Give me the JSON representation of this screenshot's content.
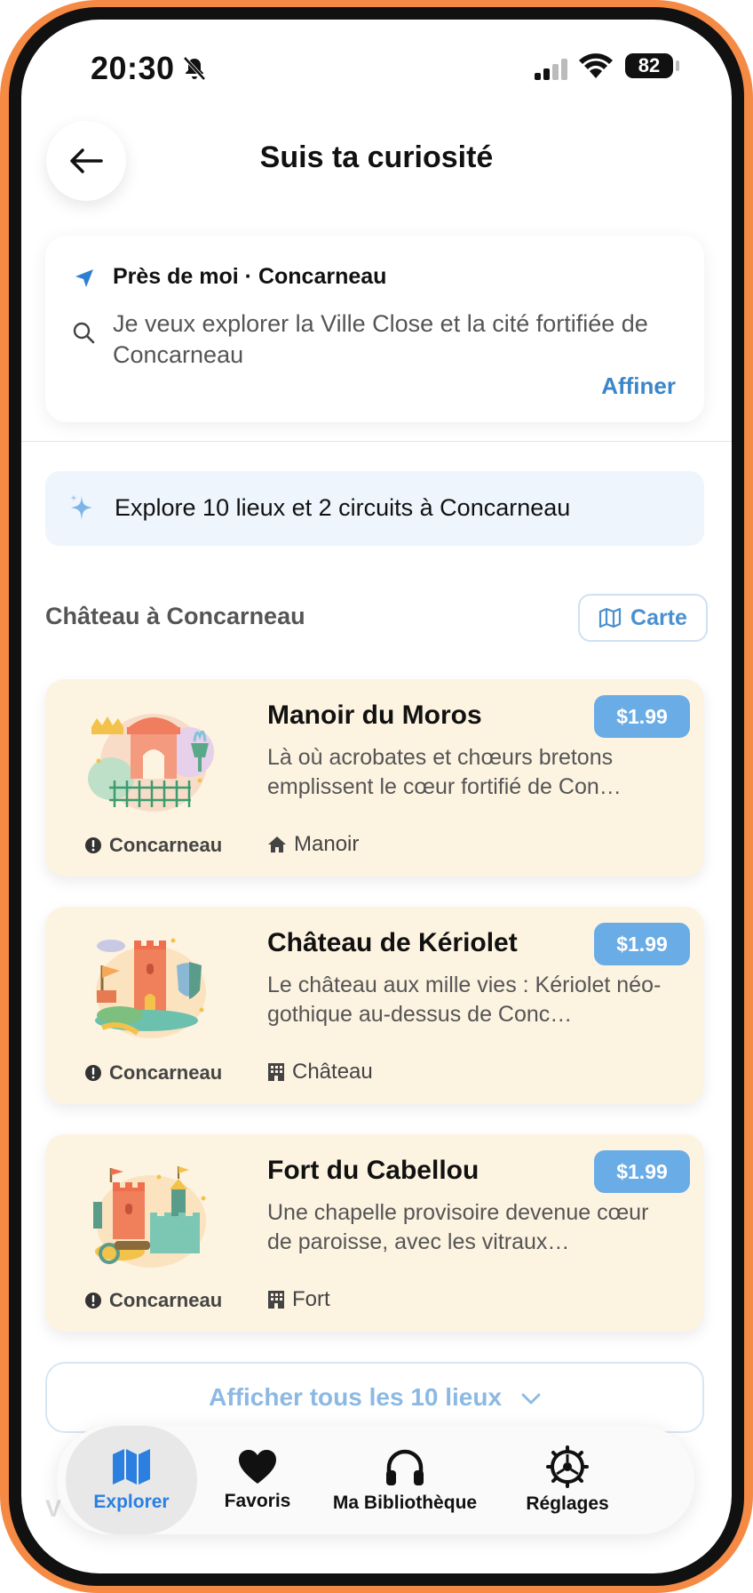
{
  "status_bar": {
    "time": "20:30",
    "battery": "82"
  },
  "header": {
    "title": "Suis ta curiosité"
  },
  "search": {
    "location": "Près de moi · Concarneau",
    "query": "Je veux explorer la Ville Close et la cité fortifiée de Concarneau",
    "refine_label": "Affiner"
  },
  "info_banner": {
    "text": "Explore 10 lieux et 2 circuits à Concarneau"
  },
  "section": {
    "title": "Château à Concarneau",
    "map_label": "Carte"
  },
  "cards": [
    {
      "title": "Manoir du Moros",
      "price": "$1.99",
      "description": "Là où acrobates et chœurs bretons emplissent le cœur fortifié de Con…",
      "city": "Concarneau",
      "tag": "Manoir",
      "tag_icon": "house-icon"
    },
    {
      "title": "Château de Kériolet",
      "price": "$1.99",
      "description": "Le château aux mille vies : Kériolet néo-gothique au-dessus de Conc…",
      "city": "Concarneau",
      "tag": "Château",
      "tag_icon": "building-icon"
    },
    {
      "title": "Fort du Cabellou",
      "price": "$1.99",
      "description": "Une chapelle provisoire devenue cœur de paroisse, avec les vitraux…",
      "city": "Concarneau",
      "tag": "Fort",
      "tag_icon": "building-icon"
    }
  ],
  "show_all": {
    "label": "Afficher tous les 10 lieux"
  },
  "next_section_hint": {
    "title": "V"
  },
  "tabbar": {
    "items": [
      {
        "label": "Explorer",
        "icon": "map-icon",
        "active": true
      },
      {
        "label": "Favoris",
        "icon": "heart-icon",
        "active": false
      },
      {
        "label": "Ma Bibliothèque",
        "icon": "headphones-icon",
        "active": false
      },
      {
        "label": "Réglages",
        "icon": "gear-icon",
        "active": false
      }
    ]
  },
  "colors": {
    "accent": "#3a86c8",
    "price_badge": "#6aace6",
    "card_bg": "#fdf3e1",
    "frame": "#f58a45",
    "tab_active": "#2b7fe0"
  }
}
